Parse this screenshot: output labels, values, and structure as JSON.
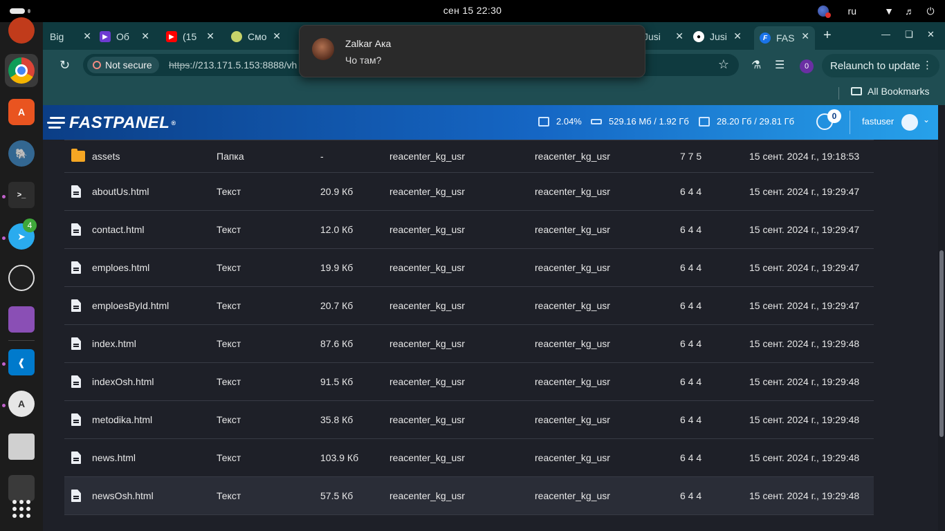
{
  "system": {
    "clock": "сен 15  22:30",
    "lang": "ru"
  },
  "dock": {
    "items": [
      {
        "name": "chrome-dev",
        "label": "Dev",
        "color": "#4285f4"
      },
      {
        "name": "app-store-a",
        "label": "A",
        "color": "#e95420"
      },
      {
        "name": "postgres",
        "label": "",
        "color": "#336791"
      },
      {
        "name": "terminal",
        "label": ">_",
        "color": "#2d2d2d"
      },
      {
        "name": "telegram",
        "label": "",
        "color": "#2aabee",
        "badge": "4"
      },
      {
        "name": "obs",
        "label": "",
        "color": "#1f1f1f"
      },
      {
        "name": "files",
        "label": "",
        "color": "#8a4fb5"
      },
      {
        "name": "vscode",
        "label": "",
        "color": "#007acc"
      },
      {
        "name": "software",
        "label": "A",
        "color": "#e6e6e6"
      }
    ]
  },
  "browser": {
    "tabs": [
      {
        "label": "Big",
        "fav_color": "#1a73e8"
      },
      {
        "label": "Об",
        "fav_color": "#6c3bd1"
      },
      {
        "label": "(15",
        "fav_color": "#ff0000"
      },
      {
        "label": "Смо",
        "fav_color": "#c6d36a"
      },
      {
        "label": "Jusi",
        "fav_color": "#555555"
      },
      {
        "label": "Jusi",
        "fav_color": "#ffffff"
      },
      {
        "label": "FAS",
        "fav_color": "#1a73e8"
      }
    ],
    "not_secure": "Not secure",
    "url_scheme": "https",
    "url_rest": "://213.171.5.153:8888/vh",
    "profile_initial": "0",
    "relaunch": "Relaunch to update",
    "all_bookmarks": "All Bookmarks"
  },
  "notification": {
    "sender": "Zalkar Ака",
    "message": "Чо там?"
  },
  "panel": {
    "logo": "FASTPANEL",
    "cpu": "2.04%",
    "ram": "529.16 Мб / 1.92 Гб",
    "disk": "28.20 Гб / 29.81 Гб",
    "tasks_count": "0",
    "username": "fastuser"
  },
  "files": [
    {
      "name": "assets",
      "type": "Папка",
      "size": "-",
      "owner": "reacenter_kg_usr",
      "group": "reacenter_kg_usr",
      "perm": "7 7 5",
      "date": "15 сент. 2024 г., 19:18:53",
      "kind": "folder"
    },
    {
      "name": "aboutUs.html",
      "type": "Текст",
      "size": "20.9 Кб",
      "owner": "reacenter_kg_usr",
      "group": "reacenter_kg_usr",
      "perm": "6 4 4",
      "date": "15 сент. 2024 г., 19:29:47",
      "kind": "file"
    },
    {
      "name": "contact.html",
      "type": "Текст",
      "size": "12.0 Кб",
      "owner": "reacenter_kg_usr",
      "group": "reacenter_kg_usr",
      "perm": "6 4 4",
      "date": "15 сент. 2024 г., 19:29:47",
      "kind": "file"
    },
    {
      "name": "emploes.html",
      "type": "Текст",
      "size": "19.9 Кб",
      "owner": "reacenter_kg_usr",
      "group": "reacenter_kg_usr",
      "perm": "6 4 4",
      "date": "15 сент. 2024 г., 19:29:47",
      "kind": "file"
    },
    {
      "name": "emploesById.html",
      "type": "Текст",
      "size": "20.7 Кб",
      "owner": "reacenter_kg_usr",
      "group": "reacenter_kg_usr",
      "perm": "6 4 4",
      "date": "15 сент. 2024 г., 19:29:47",
      "kind": "file"
    },
    {
      "name": "index.html",
      "type": "Текст",
      "size": "87.6 Кб",
      "owner": "reacenter_kg_usr",
      "group": "reacenter_kg_usr",
      "perm": "6 4 4",
      "date": "15 сент. 2024 г., 19:29:48",
      "kind": "file"
    },
    {
      "name": "indexOsh.html",
      "type": "Текст",
      "size": "91.5 Кб",
      "owner": "reacenter_kg_usr",
      "group": "reacenter_kg_usr",
      "perm": "6 4 4",
      "date": "15 сент. 2024 г., 19:29:48",
      "kind": "file"
    },
    {
      "name": "metodika.html",
      "type": "Текст",
      "size": "35.8 Кб",
      "owner": "reacenter_kg_usr",
      "group": "reacenter_kg_usr",
      "perm": "6 4 4",
      "date": "15 сент. 2024 г., 19:29:48",
      "kind": "file"
    },
    {
      "name": "news.html",
      "type": "Текст",
      "size": "103.9 Кб",
      "owner": "reacenter_kg_usr",
      "group": "reacenter_kg_usr",
      "perm": "6 4 4",
      "date": "15 сент. 2024 г., 19:29:48",
      "kind": "file"
    },
    {
      "name": "newsOsh.html",
      "type": "Текст",
      "size": "57.5 Кб",
      "owner": "reacenter_kg_usr",
      "group": "reacenter_kg_usr",
      "perm": "6 4 4",
      "date": "15 сент. 2024 г., 19:29:48",
      "kind": "file"
    }
  ]
}
